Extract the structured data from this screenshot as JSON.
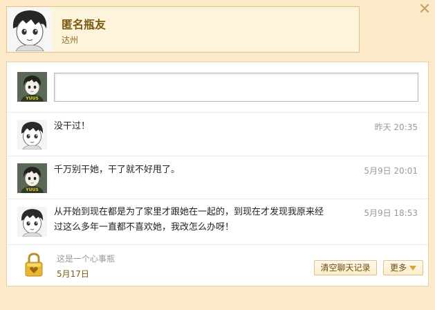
{
  "header": {
    "name": "匿名瓶友",
    "location": "达州",
    "avatar_icon": "cartoon-boy-avatar",
    "close_icon": "close-x-icon"
  },
  "compose": {
    "avatar_icon": "cartoon-boy-game-shirt-avatar",
    "input_value": "",
    "input_placeholder": ""
  },
  "messages": [
    {
      "avatar_icon": "cartoon-boy-avatar",
      "text": "没干过！",
      "time": "昨天  20:35"
    },
    {
      "avatar_icon": "cartoon-boy-game-shirt-avatar",
      "text": "千万别干她，干了就不好甩了。",
      "time": "5月9日  20:01"
    },
    {
      "avatar_icon": "cartoon-boy-avatar",
      "text_line1": "从开始到现在都是为了家里才跟她在一起的，到现在才发现我原来经",
      "text_line2": "过这么多年一直都不喜欢她，我改怎么办呀！",
      "time": "5月9日  18:53"
    }
  ],
  "footer": {
    "lock_icon": "golden-heart-padlock-icon",
    "hint": "这是一个心事瓶",
    "date": "5月17日",
    "clear_button": "清空聊天记录",
    "more_button": "更多"
  },
  "colors": {
    "page_bg": "#fbe9c8",
    "header_bg": "#fdf4dc",
    "border": "#e0c08a",
    "name_color": "#7a5a14"
  }
}
